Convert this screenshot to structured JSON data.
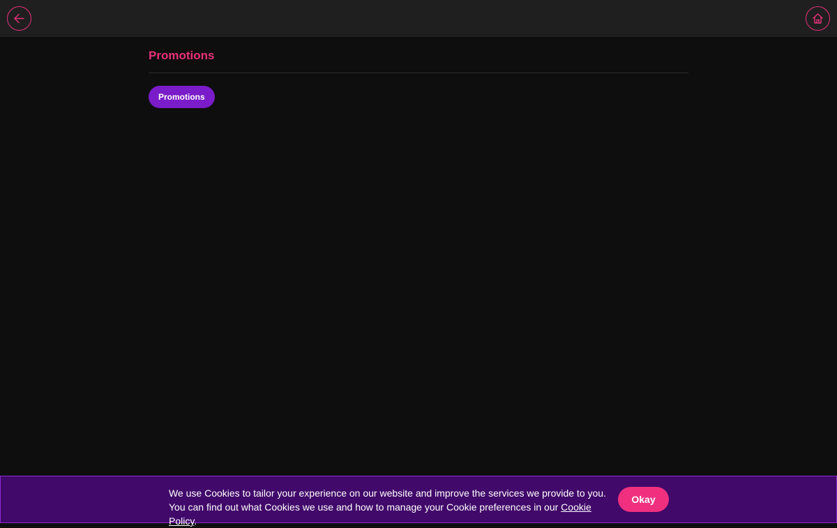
{
  "header": {
    "back_icon": "arrow-left-icon",
    "home_icon": "home-icon"
  },
  "main": {
    "title": "Promotions",
    "categories": [
      {
        "label": "Promotions",
        "active": true
      }
    ]
  },
  "cookie_banner": {
    "text": "We use Cookies to tailor your experience on our website and improve the services we provide to you. You can find out what Cookies we use and how to manage your Cookie preferences in our ",
    "link_label": "Cookie Policy",
    "trailing": ".",
    "button_label": "Okay"
  },
  "colors": {
    "accent": "#e8317a",
    "pill": "#7a1cc9",
    "banner_bg": "#41096a",
    "page_bg": "#0e0e0e",
    "topbar_bg": "#1f1f1f"
  }
}
